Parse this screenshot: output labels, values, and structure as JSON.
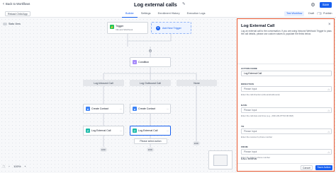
{
  "header": {
    "back_label": "Back to Workflows",
    "workflow_title": "Log external calls",
    "save_label": "Save"
  },
  "subbar": {
    "reload_label": "Reload Child App",
    "tabs": [
      {
        "label": "Builder",
        "active": true
      },
      {
        "label": "Settings",
        "active": false
      },
      {
        "label": "Enrollment History",
        "active": false
      },
      {
        "label": "Execution Logs",
        "active": false
      }
    ],
    "test_workflow_label": "Test Workflow",
    "draft_label": "Draft",
    "publish_label": "Publish"
  },
  "canvas": {
    "stats_label": "Stats View",
    "trigger": {
      "title": "Trigger",
      "subtitle": "Inbound Webhook"
    },
    "add_trigger_label": "Add New Trigger",
    "condition_label": "Condition",
    "branches": [
      "Log Inbound Call",
      "Log Outbound Call",
      "None"
    ],
    "create_contact_label": "Create Contact",
    "log_external_call_label": "Log External Call",
    "select_action_label": "Please select action",
    "end_label": "END",
    "zoom_level": "100%"
  },
  "panel": {
    "title": "Log External Call",
    "description": "Log an external call to the conversation. If you are using Inbound Webhook Trigger to pass the call details, please use custom values to populate the fields below.",
    "fields": [
      {
        "label": "ACTION NAME",
        "value": "Log External Call",
        "placeholder": "",
        "help": ""
      },
      {
        "label": "DIRECTION",
        "value": "",
        "placeholder": "Please Input",
        "help": "Enter the call direction (inbound/outbound)"
      },
      {
        "label": "DATE",
        "value": "",
        "placeholder": "Please Input",
        "help": "Enter the call date and time (e.g., 2021-09-07T10:00:00Z)"
      },
      {
        "label": "TO",
        "value": "",
        "placeholder": "Please Input",
        "help": "Enter the receiver's phone number"
      },
      {
        "label": "FROM",
        "value": "",
        "placeholder": "Please Input",
        "help": "Enter the dialer's phone number"
      },
      {
        "label": "CALL STATUS",
        "value": "",
        "placeholder": "Please Input",
        "help": ""
      }
    ],
    "cancel_label": "Cancel",
    "save_action_label": "Save Action"
  },
  "colors": {
    "accent": "#155eef",
    "panel_highlight": "#e8542b"
  }
}
